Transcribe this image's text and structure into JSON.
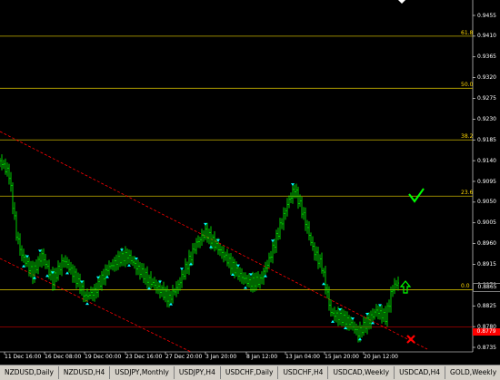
{
  "chart": {
    "price_axis": [
      "0.9455",
      "0.9410",
      "0.9365",
      "0.9320",
      "0.9275",
      "0.9230",
      "0.9185",
      "0.9140",
      "0.9095",
      "0.9050",
      "0.9005",
      "0.8960",
      "0.8915",
      "0.8870",
      "0.8825",
      "0.8780",
      "0.8735"
    ],
    "time_axis": [
      "11 Dec 16:00",
      "16 Dec 08:00",
      "19 Dec 00:00",
      "23 Dec 16:00",
      "27 Dec 20:00",
      "3 Jan 20:00",
      "8 Jan 12:00",
      "13 Jan 04:00",
      "15 Jan 20:00",
      "20 Jan 12:00"
    ],
    "fib_levels": [
      {
        "label": "61.8",
        "price": 0.941
      },
      {
        "label": "50.0",
        "price": 0.9297
      },
      {
        "label": "38.2",
        "price": 0.9185
      },
      {
        "label": "23.6",
        "price": 0.9063
      },
      {
        "label": "0.0",
        "price": 0.886
      }
    ],
    "current_price_tag": "0.8865",
    "red_level_tag": "0.8779",
    "colors": {
      "background": "#000000",
      "candles": "#00ff00",
      "fib_line": "#c8b400",
      "trend_line": "#ff0000",
      "fractal": "#00ffff",
      "check": "#00ff00",
      "cross": "#ff0000",
      "up_arrow": "#00ff00"
    },
    "markers": {
      "check_icon": "check-mark",
      "cross_icon": "x-mark",
      "arrow_icon": "up-arrow"
    }
  },
  "tabs": [
    {
      "label": "NZDUSD,Daily"
    },
    {
      "label": "NZDUSD,H4"
    },
    {
      "label": "USDJPY,Monthly"
    },
    {
      "label": "USDJPY,H4"
    },
    {
      "label": "USDCHF,Daily"
    },
    {
      "label": "USDCHF,H4"
    },
    {
      "label": "USDCAD,Weekly"
    },
    {
      "label": "USDCAD,H4"
    },
    {
      "label": "GOLD,Weekly"
    }
  ],
  "tab_nav": {
    "left": "◄",
    "right": "►"
  }
}
